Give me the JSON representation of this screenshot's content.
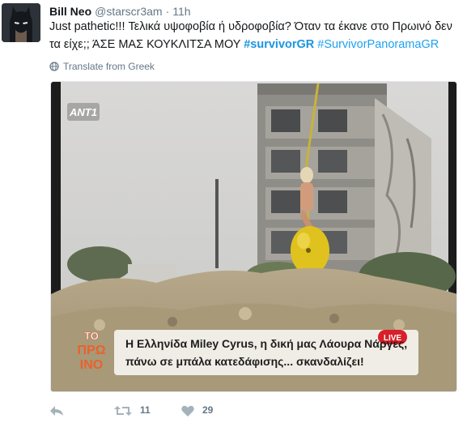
{
  "tweet": {
    "name": "Bill Neo",
    "handle": "@starscr3am",
    "separator": "·",
    "time": "11h",
    "text_part1": "Just pathetic!!! Τελικά υψοφοβία ή υδροφοβία? Όταν τα έκανε στο Πρωινό δεν τα είχε;; ΆΣΕ ΜΑΣ ΚΟΥΚΛΙΤΣΑ ΜΟΥ ",
    "hashtag1": "#survivorGR",
    "hashtag2": "#SurvivorPanoramaGR",
    "translate_label": "Translate from Greek"
  },
  "media": {
    "channel_logo": "ANT1",
    "show_logo_line1": "ΤΟ",
    "show_logo_line2": "ΠΡΩ",
    "show_logo_line3": "ΙΝΟ",
    "live_badge": "LIVE",
    "caption_line1": "Η Ελληνίδα Miley Cyrus, η δική μας Λάουρα Νάργες,",
    "caption_line2": "πάνω σε μπάλα κατεδάφισης... σκανδαλίζει!"
  },
  "actions": {
    "reply_icon": "reply-icon",
    "retweet_icon": "retweet-icon",
    "retweet_count": "11",
    "like_icon": "heart-icon",
    "like_count": "29",
    "colors": {
      "link": "#1da1f2",
      "muted": "#657786",
      "text": "#14171a"
    }
  }
}
